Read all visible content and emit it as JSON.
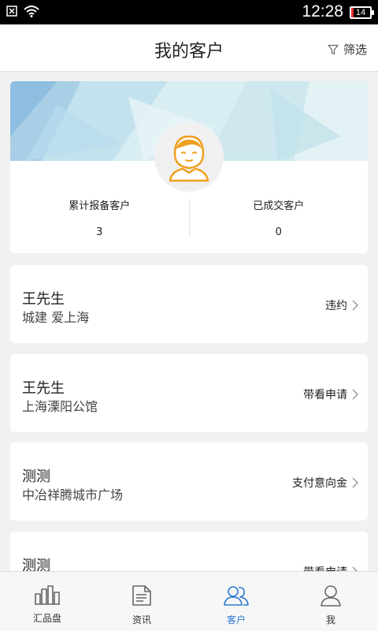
{
  "status_bar": {
    "time": "12:28",
    "battery": "14"
  },
  "header": {
    "title": "我的客户",
    "filter_label": "筛选"
  },
  "profile": {
    "stats": [
      {
        "label": "累计报备客户",
        "value": "3"
      },
      {
        "label": "已成交客户",
        "value": "0"
      }
    ]
  },
  "clients": [
    {
      "name": "王先生",
      "project": "城建 爱上海",
      "status": "违约"
    },
    {
      "name": "王先生",
      "project": "上海溧阳公馆",
      "status": "带看申请"
    },
    {
      "name": "测测",
      "project": "中冶祥腾城市广场",
      "status": "支付意向金"
    },
    {
      "name": "测测",
      "project": "",
      "status": "带看申请"
    }
  ],
  "tabs": [
    {
      "label": "汇品盘",
      "icon": "building-icon",
      "active": false
    },
    {
      "label": "资讯",
      "icon": "document-icon",
      "active": false
    },
    {
      "label": "客户",
      "icon": "customers-icon",
      "active": true
    },
    {
      "label": "我",
      "icon": "person-icon",
      "active": false
    }
  ],
  "colors": {
    "accent": "#2a7bd3",
    "avatar_orange": "#f0a020",
    "battery_low": "#e33333"
  }
}
